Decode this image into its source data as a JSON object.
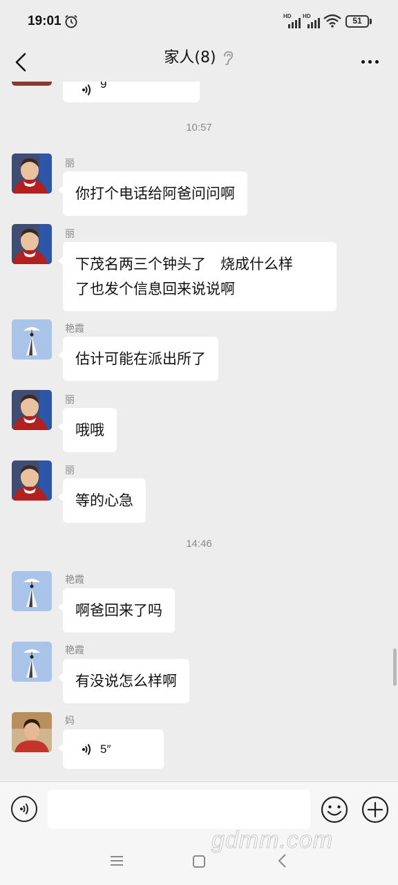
{
  "status_bar": {
    "time": "19:01",
    "network_1": "HD",
    "network_2": "HD",
    "battery": "51"
  },
  "header": {
    "title": "家人(8)"
  },
  "messages": {
    "prev_voice_duration": "9",
    "divider_1": "10:57",
    "m1": {
      "sender": "丽",
      "text": "你打个电话给阿爸问问啊"
    },
    "m2": {
      "sender": "丽",
      "line1": "下茂名两三个钟头了　烧成什么样",
      "line2": "了也发个信息回来说说啊"
    },
    "m3": {
      "sender": "艳霞",
      "text": "估计可能在派出所了"
    },
    "m4": {
      "sender": "丽",
      "text": "哦哦"
    },
    "m5": {
      "sender": "丽",
      "text": "等的心急"
    },
    "divider_2": "14:46",
    "m6": {
      "sender": "艳霞",
      "text": "啊爸回来了吗"
    },
    "m7": {
      "sender": "艳霞",
      "text": "有没说怎么样啊"
    },
    "m8": {
      "sender": "妈",
      "voice_duration": "5″"
    }
  },
  "input": {
    "placeholder": ""
  },
  "watermark": "gdmm.com",
  "icons": {
    "back": "chevron-left-icon",
    "ear": "ear-icon",
    "more": "more-dots-icon",
    "voice": "voice-icon",
    "emoji": "emoji-icon",
    "plus": "plus-icon"
  },
  "colors": {
    "background": "#ededed",
    "bubble": "#ffffff",
    "meta_text": "#8a8a8a"
  }
}
